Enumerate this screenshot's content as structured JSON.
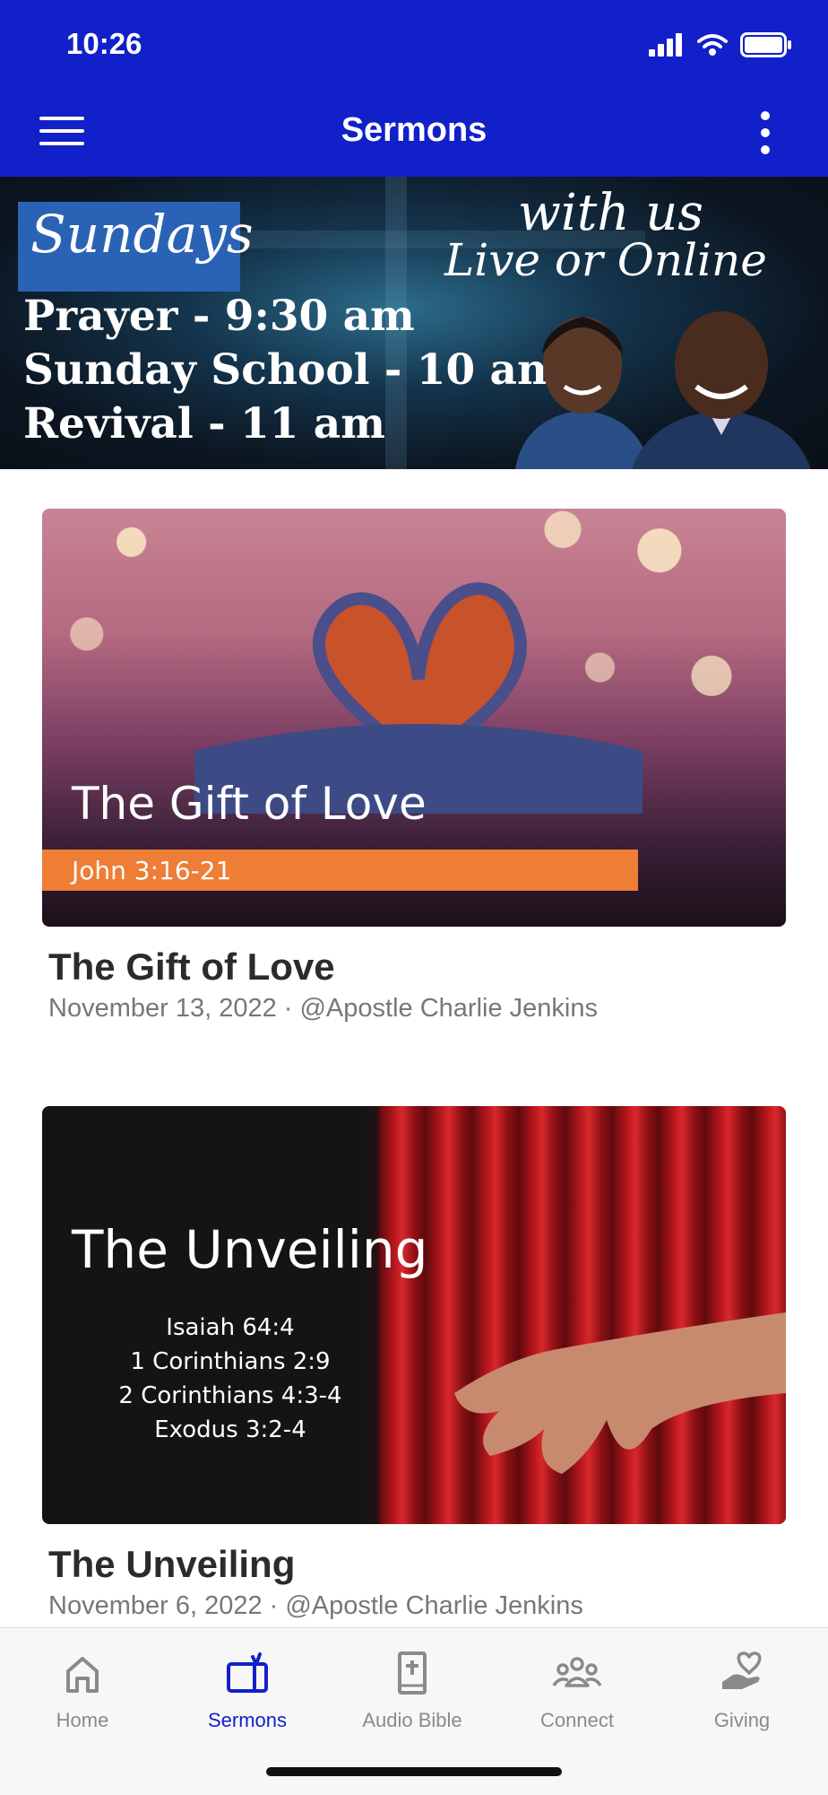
{
  "status_bar": {
    "time": "10:26"
  },
  "navbar": {
    "title": "Sermons",
    "menu_icon": "hamburger-menu-icon",
    "more_icon": "more-vertical-icon"
  },
  "banner": {
    "sundays": "Sundays",
    "with_us": "with us",
    "live_online": "Live or Online",
    "schedule": [
      "Prayer - 9:30 am",
      "Sunday School - 10 am",
      "Revival - 11 am"
    ]
  },
  "sermons": [
    {
      "title": "The Gift of Love",
      "date": "November 13, 2022",
      "speaker": "@Apostle Charlie Jenkins",
      "meta": "November 13, 2022 · @Apostle Charlie Jenkins",
      "image_title": "The Gift of Love",
      "image_subtitle": "John 3:16-21"
    },
    {
      "title": "The Unveiling",
      "date": "November 6, 2022",
      "speaker": "@Apostle Charlie Jenkins",
      "meta": "November 6, 2022 · @Apostle Charlie Jenkins",
      "image_title": "The Unveiling",
      "image_scriptures": [
        "Isaiah 64:4",
        "1 Corinthians 2:9",
        "2 Corinthians 4:3-4",
        "Exodus 3:2-4"
      ]
    }
  ],
  "tabbar": {
    "tabs": [
      {
        "label": "Home",
        "icon": "home-icon",
        "active": false
      },
      {
        "label": "Sermons",
        "icon": "tv-icon",
        "active": true
      },
      {
        "label": "Audio Bible",
        "icon": "bible-icon",
        "active": false
      },
      {
        "label": "Connect",
        "icon": "people-icon",
        "active": false
      },
      {
        "label": "Giving",
        "icon": "giving-heart-hand-icon",
        "active": false
      }
    ]
  },
  "colors": {
    "header": "#1220c9",
    "active_tab": "#1220c9",
    "inactive_tab": "#8a8a8a",
    "scripture_band": "#ee7d35"
  }
}
